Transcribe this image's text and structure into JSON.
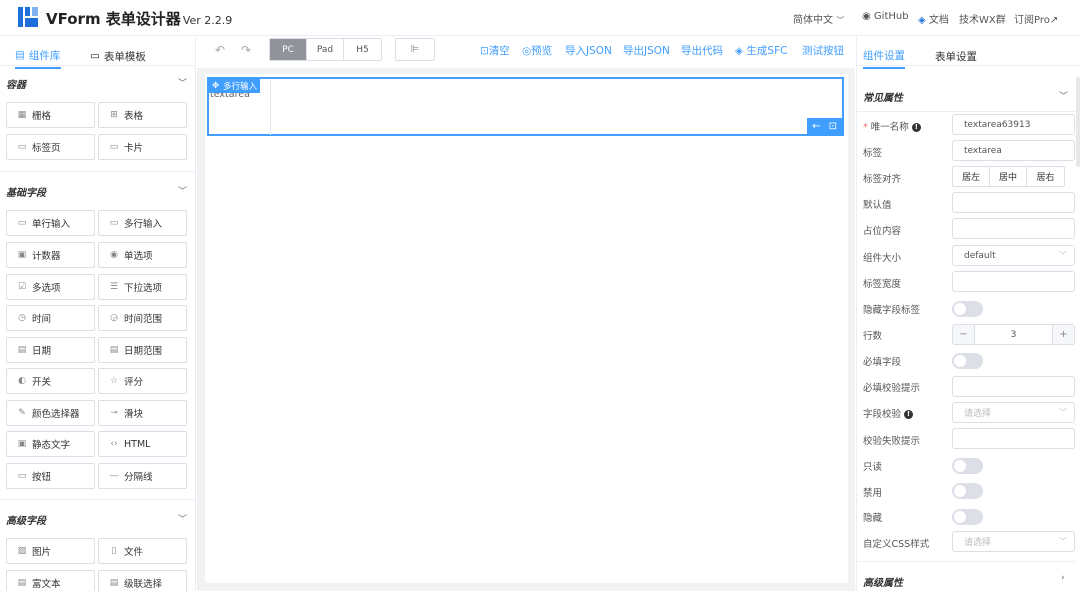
{
  "header": {
    "title": "VForm 表单设计器",
    "version": "Ver 2.2.9",
    "lang": "简体中文",
    "github": "GitHub",
    "docs": "文档",
    "wx": "技术WX群",
    "pro": "订阅Pro↗"
  },
  "left": {
    "tabs": [
      "组件库",
      "表单模板"
    ],
    "sections": [
      {
        "title": "容器",
        "items": [
          "栅格",
          "表格",
          "标签页",
          "卡片"
        ]
      },
      {
        "title": "基础字段",
        "items": [
          "单行输入",
          "多行输入",
          "计数器",
          "单选项",
          "多选项",
          "下拉选项",
          "时间",
          "时间范围",
          "日期",
          "日期范围",
          "开关",
          "评分",
          "颜色选择器",
          "滑块",
          "静态文字",
          "HTML",
          "按钮",
          "分隔线"
        ]
      },
      {
        "title": "高级字段",
        "items": [
          "图片",
          "文件",
          "富文本",
          "级联选择"
        ]
      }
    ]
  },
  "toolbar": {
    "devices": [
      "PC",
      "Pad",
      "H5"
    ],
    "actions": [
      "清空",
      "预览",
      "导入JSON",
      "导出JSON",
      "导出代码",
      "生成SFC",
      "测试按钮"
    ]
  },
  "canvas": {
    "field_tag": "多行输入",
    "field_label": "textarea"
  },
  "right": {
    "tabs": [
      "组件设置",
      "表单设置"
    ],
    "common_title": "常见属性",
    "advanced_title": "高级属性",
    "props": {
      "name_label": "唯一名称",
      "name_value": "textarea63913",
      "label_label": "标签",
      "label_value": "textarea",
      "align_label": "标签对齐",
      "align_options": [
        "居左",
        "居中",
        "居右"
      ],
      "default_label": "默认值",
      "placeholder_label": "占位内容",
      "size_label": "组件大小",
      "size_value": "default",
      "labelwidth_label": "标签宽度",
      "hidelabel_label": "隐藏字段标签",
      "rows_label": "行数",
      "rows_value": "3",
      "required_label": "必填字段",
      "required_hint_label": "必填校验提示",
      "validation_label": "字段校验",
      "validation_placeholder": "请选择",
      "validation_fail_label": "校验失败提示",
      "readonly_label": "只读",
      "disabled_label": "禁用",
      "hidden_label": "隐藏",
      "css_label": "自定义CSS样式",
      "css_placeholder": "请选择"
    }
  }
}
